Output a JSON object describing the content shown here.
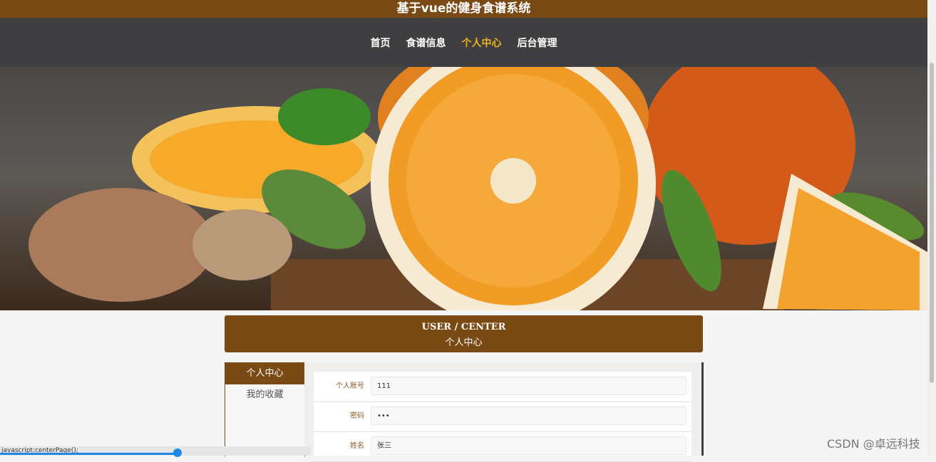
{
  "header": {
    "title": "基于vue的健身食谱系统"
  },
  "nav": {
    "items": [
      "首页",
      "食谱信息",
      "个人中心",
      "后台管理"
    ],
    "active_index": 2
  },
  "banner": {
    "slide_count": 3,
    "active_slide": 1
  },
  "user_center": {
    "title_en": "USER / CENTER",
    "title_cn": "个人中心"
  },
  "sidebar": {
    "items": [
      "个人中心",
      "我的收藏"
    ],
    "active_index": 0
  },
  "form": {
    "fields": [
      {
        "label": "个人账号",
        "value": "111"
      },
      {
        "label": "密码",
        "value": "•••"
      },
      {
        "label": "姓名",
        "value": "张三"
      }
    ]
  },
  "status": {
    "url": "javascript:centerPage();",
    "progress": 0.19
  },
  "watermark": "CSDN @卓远科技",
  "colors": {
    "brand": "#7a4a14",
    "nav_bg": "#3f3f42",
    "nav_active": "#f0b21d"
  }
}
